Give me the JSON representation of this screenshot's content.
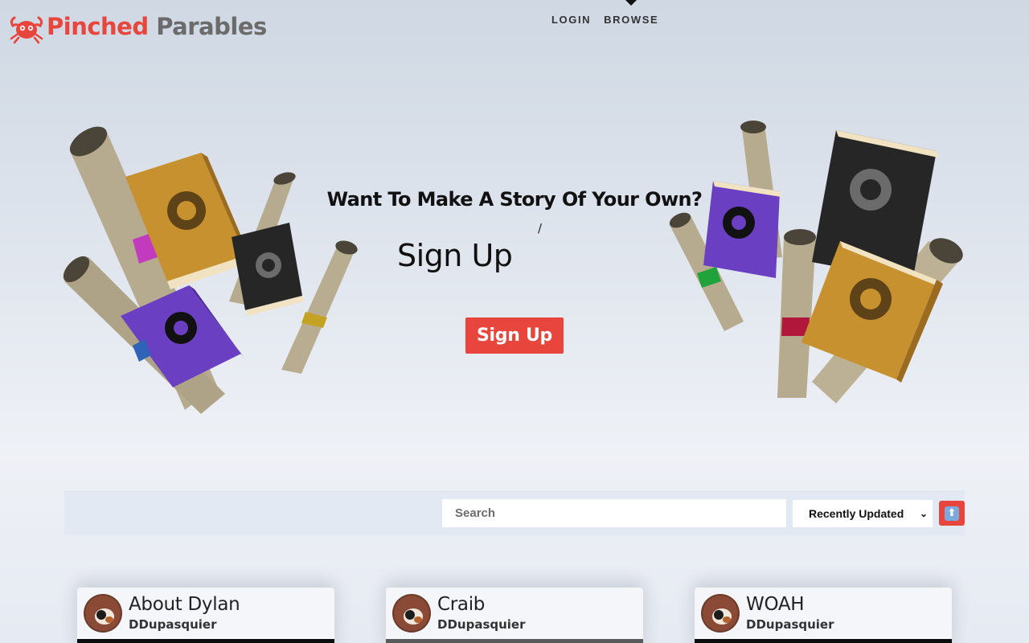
{
  "header": {
    "logo_part1": "Pinched",
    "logo_part2": " Parables",
    "nav": [
      {
        "label": "LOGIN"
      },
      {
        "label": "BROWSE",
        "active": true
      }
    ]
  },
  "hero": {
    "title": "Want To Make A Story Of Your Own?",
    "cursor": "/",
    "typed_text": "Sign Up",
    "button_label": "Sign Up"
  },
  "toolbar": {
    "search_placeholder": "Search",
    "sort_selected": "Recently Updated",
    "order_icon": "up-arrow-icon"
  },
  "stories": [
    {
      "title": "About Dylan",
      "author": "DDupasquier"
    },
    {
      "title": "Craib",
      "author": "DDupasquier"
    },
    {
      "title": "WOAH",
      "author": "DDupasquier"
    }
  ],
  "colors": {
    "accent": "#e8453c",
    "purple_book": "#6a3fc2",
    "gold_book": "#c8912f",
    "black_book": "#262626",
    "scroll": "#b8ac8e"
  }
}
